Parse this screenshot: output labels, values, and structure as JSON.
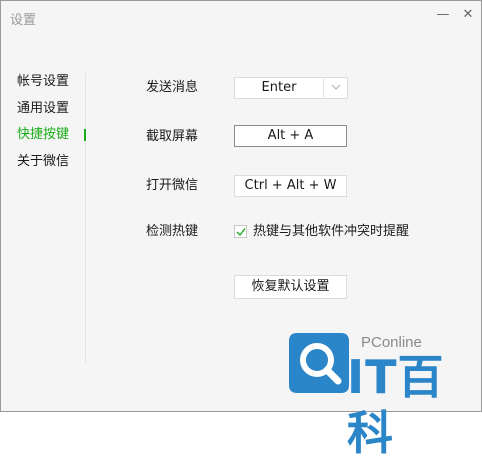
{
  "window": {
    "title": "设置",
    "minimize_glyph": "—",
    "close_glyph": "✕"
  },
  "sidebar": {
    "items": [
      {
        "label": "帐号设置"
      },
      {
        "label": "通用设置"
      },
      {
        "label": "快捷按键",
        "active": true
      },
      {
        "label": "关于微信"
      }
    ]
  },
  "shortcuts": {
    "send_message": {
      "label": "发送消息",
      "value": "Enter"
    },
    "screenshot": {
      "label": "截取屏幕",
      "value": "Alt + A"
    },
    "open_wechat": {
      "label": "打开微信",
      "value": "Ctrl + Alt + W"
    },
    "hotkey_check": {
      "label": "检测热键",
      "checkbox_label": "热键与其他软件冲突时提醒",
      "checked": true
    }
  },
  "reset_button": {
    "label": "恢复默认设置"
  },
  "watermark": {
    "brand": "PConline",
    "name": "IT百科"
  },
  "colors": {
    "accent": "#1aad19",
    "watermark_blue": "#2a86c8"
  }
}
